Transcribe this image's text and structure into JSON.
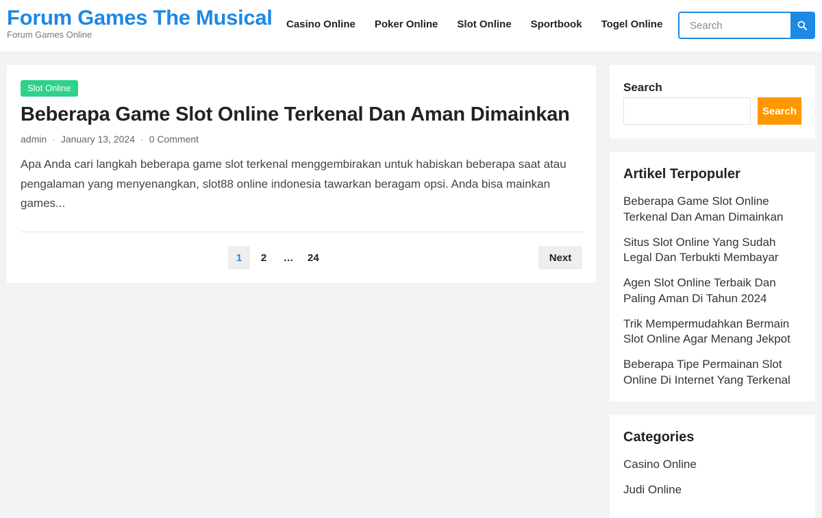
{
  "site": {
    "title": "Forum Games The Musical",
    "tagline": "Forum Games Online"
  },
  "nav": {
    "items": [
      {
        "label": "Casino Online"
      },
      {
        "label": "Poker Online"
      },
      {
        "label": "Slot Online"
      },
      {
        "label": "Sportbook"
      },
      {
        "label": "Togel Online"
      }
    ]
  },
  "header_search": {
    "placeholder": "Search",
    "button_icon": "search-icon",
    "accent_color": "#1e88e5"
  },
  "post": {
    "category": "Slot Online",
    "category_color": "#2ed189",
    "title": "Beberapa Game Slot Online Terkenal Dan Aman Dimainkan",
    "author": "admin",
    "date": "January 13, 2024",
    "comments": "0 Comment",
    "excerpt": "Apa Anda cari langkah beberapa game slot terkenal menggembirakan untuk habiskan beberapa saat atau pengalaman yang menyenangkan, slot88 online indonesia tawarkan beragam opsi. Anda bisa mainkan games..."
  },
  "pagination": {
    "pages": [
      "1",
      "2",
      "…",
      "24"
    ],
    "current": "1",
    "next_label": "Next"
  },
  "sidebar": {
    "search": {
      "title": "Search",
      "value": "",
      "button_label": "Search",
      "button_color": "#ff9800"
    },
    "popular": {
      "title": "Artikel Terpopuler",
      "items": [
        "Beberapa Game Slot Online Terkenal Dan Aman Dimainkan",
        "Situs Slot Online Yang Sudah Legal Dan Terbukti Membayar",
        "Agen Slot Online Terbaik Dan Paling Aman Di Tahun 2024",
        "Trik Mempermudahkan Bermain Slot Online Agar Menang Jekpot",
        "Beberapa Tipe Permainan Slot Online Di Internet Yang Terkenal"
      ]
    },
    "categories": {
      "title": "Categories",
      "items": [
        "Casino Online",
        "Judi Online"
      ]
    }
  }
}
